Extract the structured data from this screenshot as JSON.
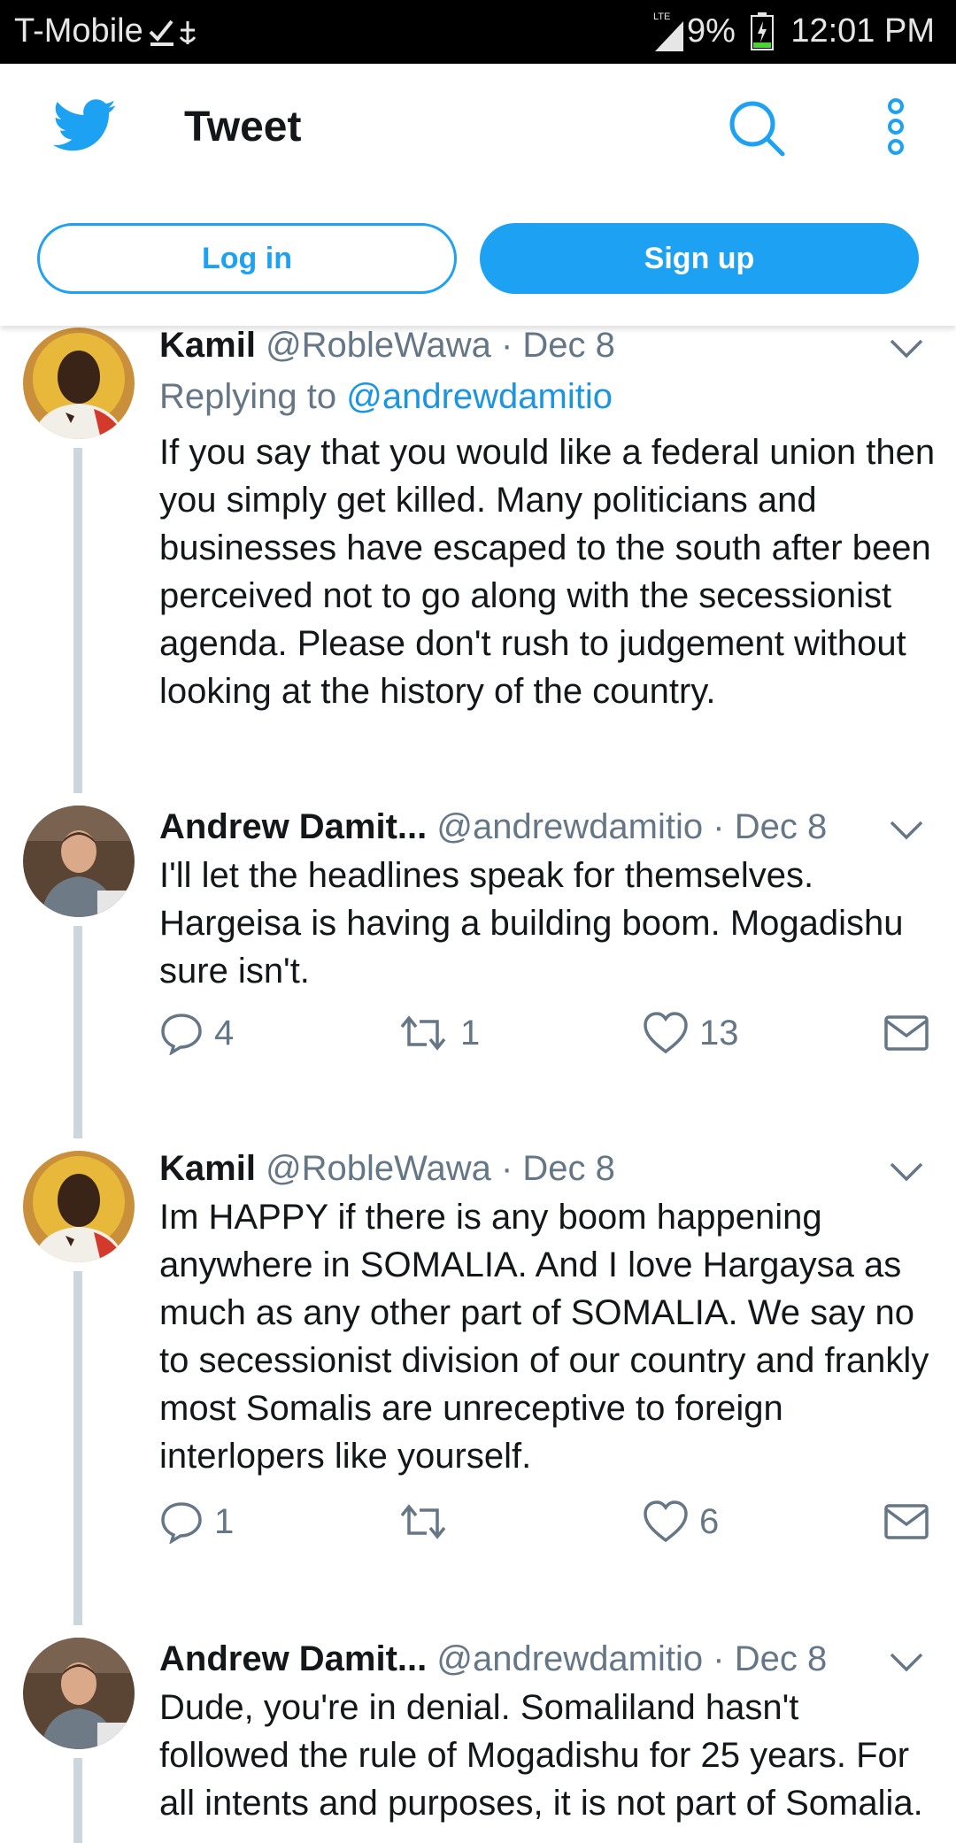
{
  "status_bar": {
    "carrier": "T-Mobile",
    "network": "LTE",
    "battery_percent": "9%",
    "time": "12:01 PM"
  },
  "header": {
    "title": "Tweet",
    "login_label": "Log in",
    "signup_label": "Sign up",
    "brand_color": "#1da1f2"
  },
  "tweets": [
    {
      "name": "Kamil",
      "handle": "@RobleWawa",
      "date": "· Dec 8",
      "replying_prefix": "Replying to",
      "replying_handle": "@andrewdamitio",
      "text": "If you say that you would like a federal union then you simply get killed. Many politicians and businesses have escaped to the south after been perceived not to go along with the secessionist agenda. Please don't rush to judgement without looking at the history of the country."
    },
    {
      "name": "Andrew Damit...",
      "handle": "@andrewdamitio",
      "date": "· Dec 8",
      "text": "I'll let the headlines speak for themselves. Hargeisa is having a building boom. Mogadishu sure isn't.",
      "replies": "4",
      "retweets": "1",
      "likes": "13"
    },
    {
      "name": "Kamil",
      "handle": "@RobleWawa",
      "date": "· Dec 8",
      "text": "Im HAPPY if there is any boom happening anywhere in SOMALIA. And I love Hargaysa as much as any other part of SOMALIA. We say no to secessionist division of our country and frankly most Somalis are unreceptive to foreign interlopers like yourself.",
      "replies": "1",
      "retweets": "",
      "likes": "6"
    },
    {
      "name": "Andrew Damit...",
      "handle": "@andrewdamitio",
      "date": "· Dec 8",
      "text": "Dude, you're in denial. Somaliland hasn't followed the rule of Mogadishu for 25 years. For all intents and purposes, it is not part of Somalia."
    }
  ]
}
